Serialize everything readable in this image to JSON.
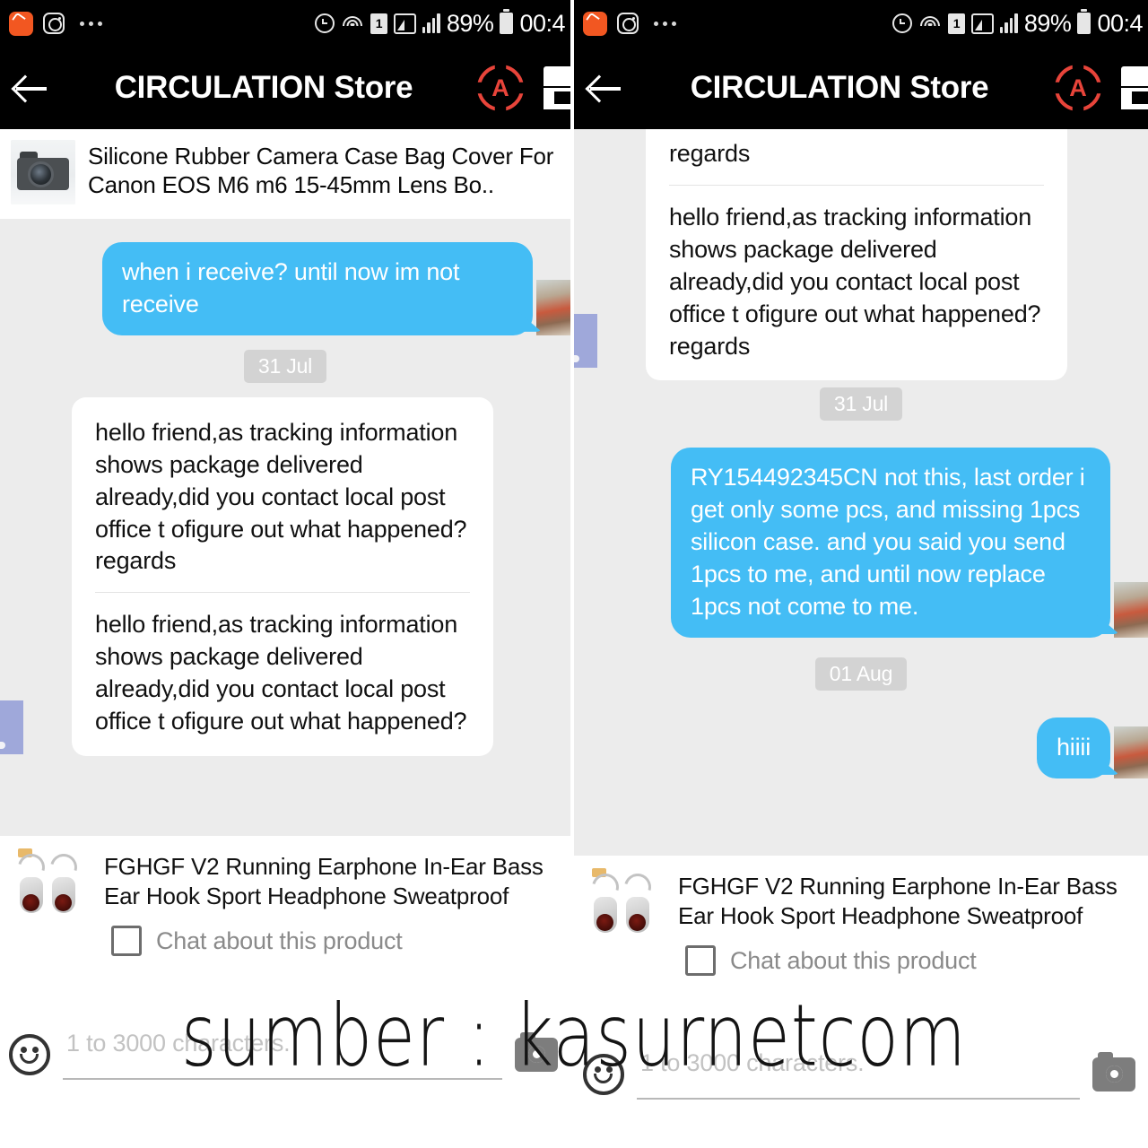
{
  "status_bar": {
    "icons": [
      "mi-icon",
      "instagram-icon",
      "overflow-dots-icon",
      "alarm-icon",
      "wifi-icon",
      "sim-card-icon",
      "signal-box-icon",
      "signal-bars-icon",
      "battery-icon"
    ],
    "sim_label": "1",
    "battery_percent": "89%",
    "time": "00:4"
  },
  "app_bar": {
    "title": "CIRCULATION Store",
    "back_icon": "back-arrow-icon",
    "aliexpress_icon": "aliexpress-a-icon",
    "aliexpress_letter": "A",
    "store_icon": "store-icon",
    "accent_red": "#e8443a"
  },
  "product_header": {
    "title": "Silicone Rubber Camera Case Bag Cover For Canon EOS M6 m6 15-45mm Lens Bo..",
    "thumb_icon": "camera-product-thumbnail"
  },
  "left_panel": {
    "messages": [
      {
        "side": "out",
        "text": "when i receive? until now im not receive"
      }
    ],
    "date_pill": "31 Jul",
    "incoming_card": {
      "segments": [
        "hello friend,as tracking information shows package delivered already,did you contact local post office t ofigure out what happened? regards",
        "hello friend,as tracking information shows package delivered already,did you contact local post office t ofigure out what happened?"
      ]
    }
  },
  "right_panel": {
    "top_card": {
      "partial_tail": "regards",
      "segment": "hello friend,as tracking information shows package delivered already,did you contact local post office t ofigure out what happened? regards"
    },
    "date_pill_1": "31 Jul",
    "outgoing_long": "RY154492345CN not this, last order i get only some pcs, and missing 1pcs silicon case. and you said you send 1pcs to me, and until now replace 1pcs not come to me.",
    "date_pill_2": "01 Aug",
    "outgoing_short": "hiiii"
  },
  "bottom_product": {
    "title": "FGHGF V2 Running Earphone In-Ear Bass Ear Hook Sport Headphone Sweatproof",
    "thumb_icon": "earphone-product-thumbnail",
    "checkbox_label": "Chat about this product",
    "checkbox_icon": "checkbox-unchecked-icon"
  },
  "input_bar": {
    "emoji_icon": "emoji-smiley-icon",
    "placeholder": "1 to 3000 characters.",
    "value": "",
    "camera_icon": "camera-icon"
  },
  "watermark": {
    "text": "sumber : kasurnetcom"
  },
  "colors": {
    "outgoing_bubble": "#44bdf5",
    "chat_background": "#ececec",
    "app_bar": "#000000",
    "date_pill": "#d3d3d3"
  }
}
